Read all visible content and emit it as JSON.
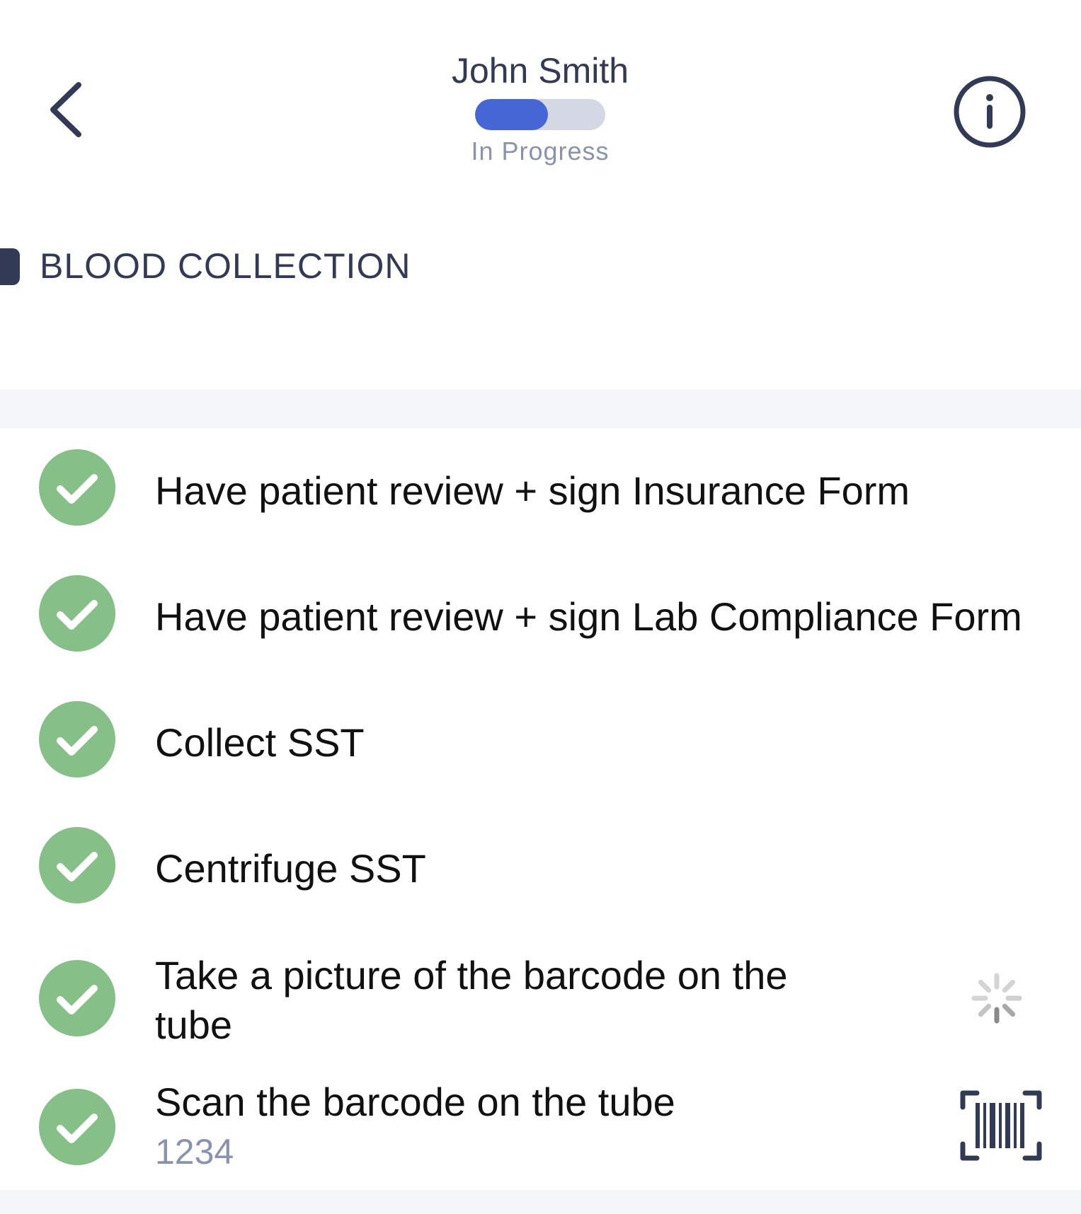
{
  "header": {
    "patient_name": "John Smith",
    "progress_fraction": 0.56,
    "status": "In Progress",
    "back_icon": "chevron-left-icon",
    "info_icon": "info-circle-icon"
  },
  "section": {
    "title": "BLOOD COLLECTION"
  },
  "tasks": [
    {
      "label": "Have patient review + sign Insurance Form",
      "done": true
    },
    {
      "label": "Have patient review + sign Lab Compliance Form",
      "done": true
    },
    {
      "label": "Collect SST",
      "done": true
    },
    {
      "label": "Centrifuge SST",
      "done": true
    },
    {
      "label": "Take a picture of the barcode on the tube",
      "done": true,
      "trailing_icon": "loading-spinner-icon"
    },
    {
      "label": "Scan the barcode on the tube",
      "value": "1234",
      "done": true,
      "trailing_icon": "barcode-scan-icon"
    }
  ],
  "colors": {
    "accent": "#4766d6",
    "complete": "#86bf87",
    "heading": "#333a56",
    "muted": "#8a93ae"
  }
}
